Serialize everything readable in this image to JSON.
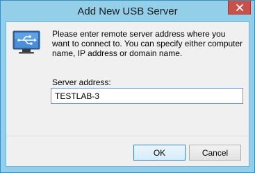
{
  "window": {
    "title": "Add New USB Server"
  },
  "dialog": {
    "message": "Please enter remote server address where you want to connect to. You can specify either computer name, IP address or domain name.",
    "address_label": "Server address:",
    "address_value": "TESTLAB-3"
  },
  "buttons": {
    "ok_label": "OK",
    "cancel_label": "Cancel"
  },
  "icons": {
    "close": "close-icon",
    "app": "usb-monitor-icon"
  },
  "colors": {
    "frame": "#93cfe9",
    "close_button": "#c7504a",
    "input_border": "#569de5",
    "icon_accent": "#3a73b7"
  }
}
